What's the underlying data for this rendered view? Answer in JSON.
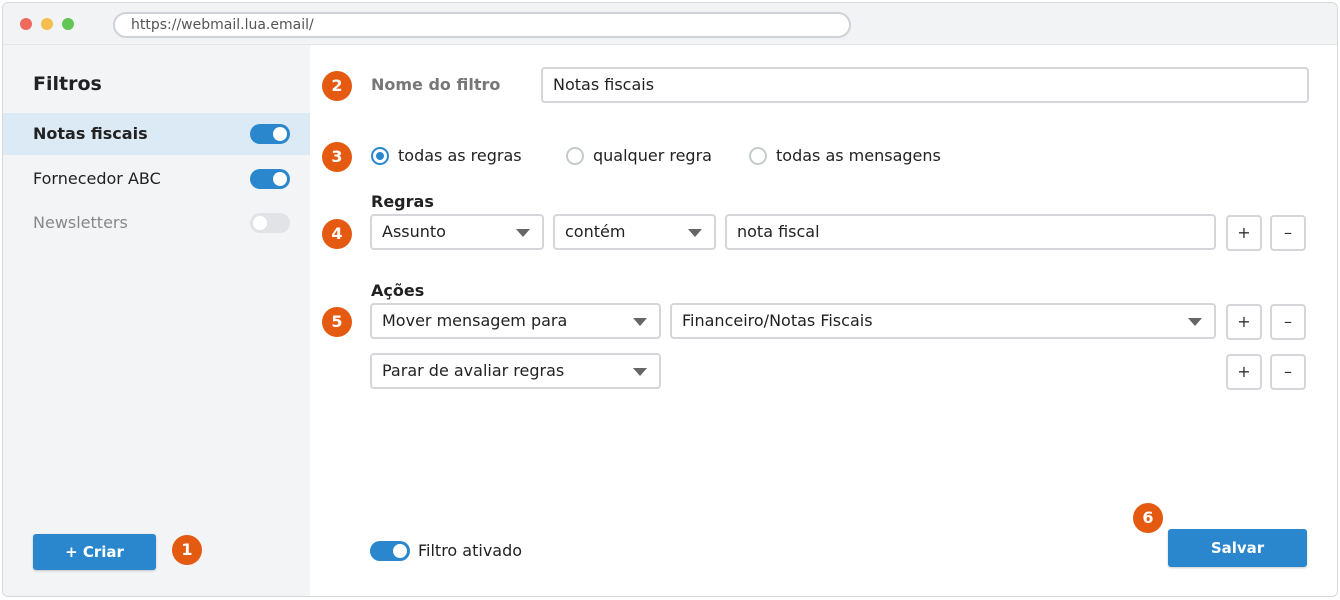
{
  "browser": {
    "url": "https://webmail.lua.email/"
  },
  "sidebar": {
    "title": "Filtros",
    "filters": [
      {
        "name": "Notas fiscais",
        "enabled": true,
        "selected": true
      },
      {
        "name": "Fornecedor ABC",
        "enabled": true,
        "selected": false
      },
      {
        "name": "Newsletters",
        "enabled": false,
        "selected": false
      }
    ],
    "create_label": "+ Criar"
  },
  "badges": [
    "1",
    "2",
    "3",
    "4",
    "5",
    "6"
  ],
  "form": {
    "name_label": "Nome do filtro",
    "name_value": "Notas fiscais",
    "match_options": [
      {
        "label": "todas as regras",
        "checked": true
      },
      {
        "label": "qualquer regra",
        "checked": false
      },
      {
        "label": "todas as mensagens",
        "checked": false
      }
    ],
    "rules_label": "Regras",
    "rule": {
      "field": "Assunto",
      "operator": "contém",
      "value": "nota fiscal"
    },
    "actions_label": "Ações",
    "actions": [
      {
        "action": "Mover mensagem para",
        "target": "Financeiro/Notas Fiscais"
      },
      {
        "action": "Parar de avaliar regras"
      }
    ],
    "add_label": "+",
    "remove_label": "–",
    "enabled_label": "Filtro ativado",
    "save_label": "Salvar"
  },
  "colors": {
    "accent": "#2a87cd",
    "badge": "#e35a10",
    "sidebar_bg": "#f3f4f6",
    "selected_bg": "#dceaf6"
  }
}
